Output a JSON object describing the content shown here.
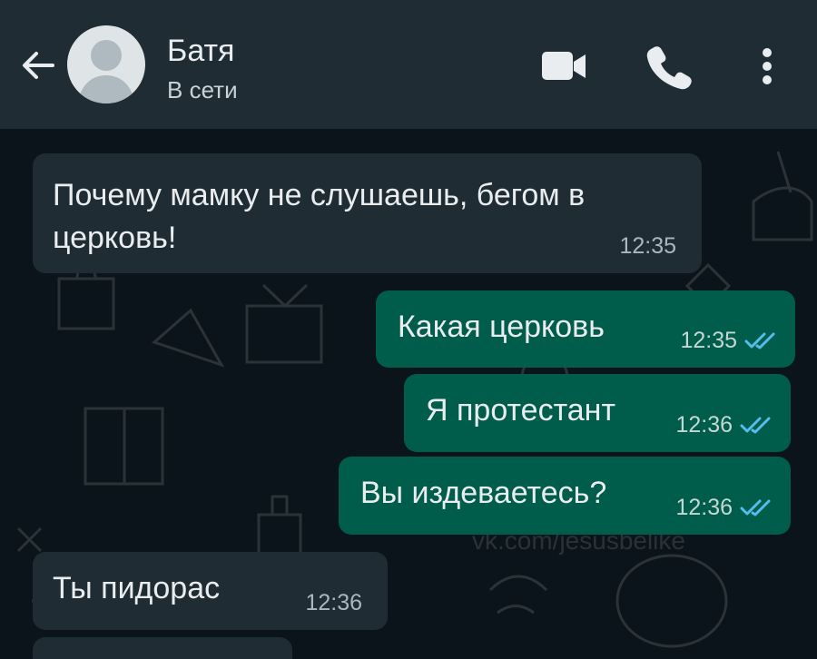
{
  "header": {
    "contact_name": "Батя",
    "status": "В сети",
    "icons": [
      "back-arrow-icon",
      "avatar-placeholder",
      "video-camera-icon",
      "phone-icon",
      "more-vertical-icon"
    ],
    "colors": {
      "header": "#1f2c34",
      "text": "#e9edef"
    }
  },
  "chat": {
    "colors": {
      "background": "#0b141a",
      "incoming": "#1f2c34",
      "outgoing": "#005c4b",
      "read_ticks": "#53bdeb"
    },
    "messages": [
      {
        "direction": "in",
        "text": "Почему мамку не слушаешь, бегом в церковь!",
        "line1": "Почему мамку не слушаешь, бегом в",
        "line2": "церковь!",
        "time": "12:35"
      },
      {
        "direction": "out",
        "text": "Какая церковь",
        "time": "12:35",
        "status": "read"
      },
      {
        "direction": "out",
        "text": "Я протестант",
        "time": "12:36",
        "status": "read"
      },
      {
        "direction": "out",
        "text": "Вы издеваетесь?",
        "time": "12:36",
        "status": "read"
      },
      {
        "direction": "in",
        "text": "Ты пидорас",
        "time": "12:36"
      }
    ]
  },
  "watermark": "vk.com/jesusbelike"
}
